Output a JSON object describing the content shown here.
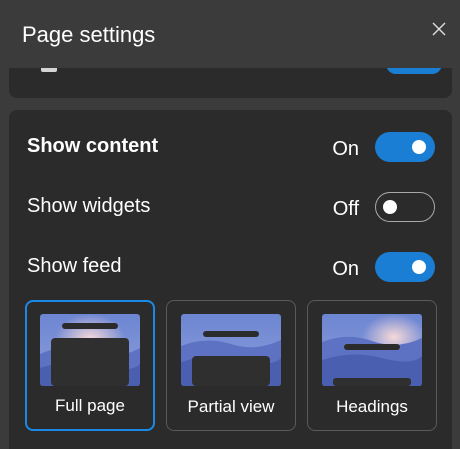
{
  "window": {
    "title": "Page settings",
    "close_icon": "close-icon"
  },
  "settings": [
    {
      "label": "Show content",
      "state": "On",
      "enabled": true
    },
    {
      "label": "Show widgets",
      "state": "Off",
      "enabled": false
    },
    {
      "label": "Show feed",
      "state": "On",
      "enabled": true
    }
  ],
  "layout_options": [
    {
      "label": "Full page",
      "selected": true
    },
    {
      "label": "Partial view",
      "selected": false
    },
    {
      "label": "Headings",
      "selected": false
    }
  ],
  "colors": {
    "accent": "#1a7fd4",
    "selected_border": "#1a8ae6",
    "card_background": "#2b2b2b",
    "panel_background": "#3b3b3b"
  }
}
